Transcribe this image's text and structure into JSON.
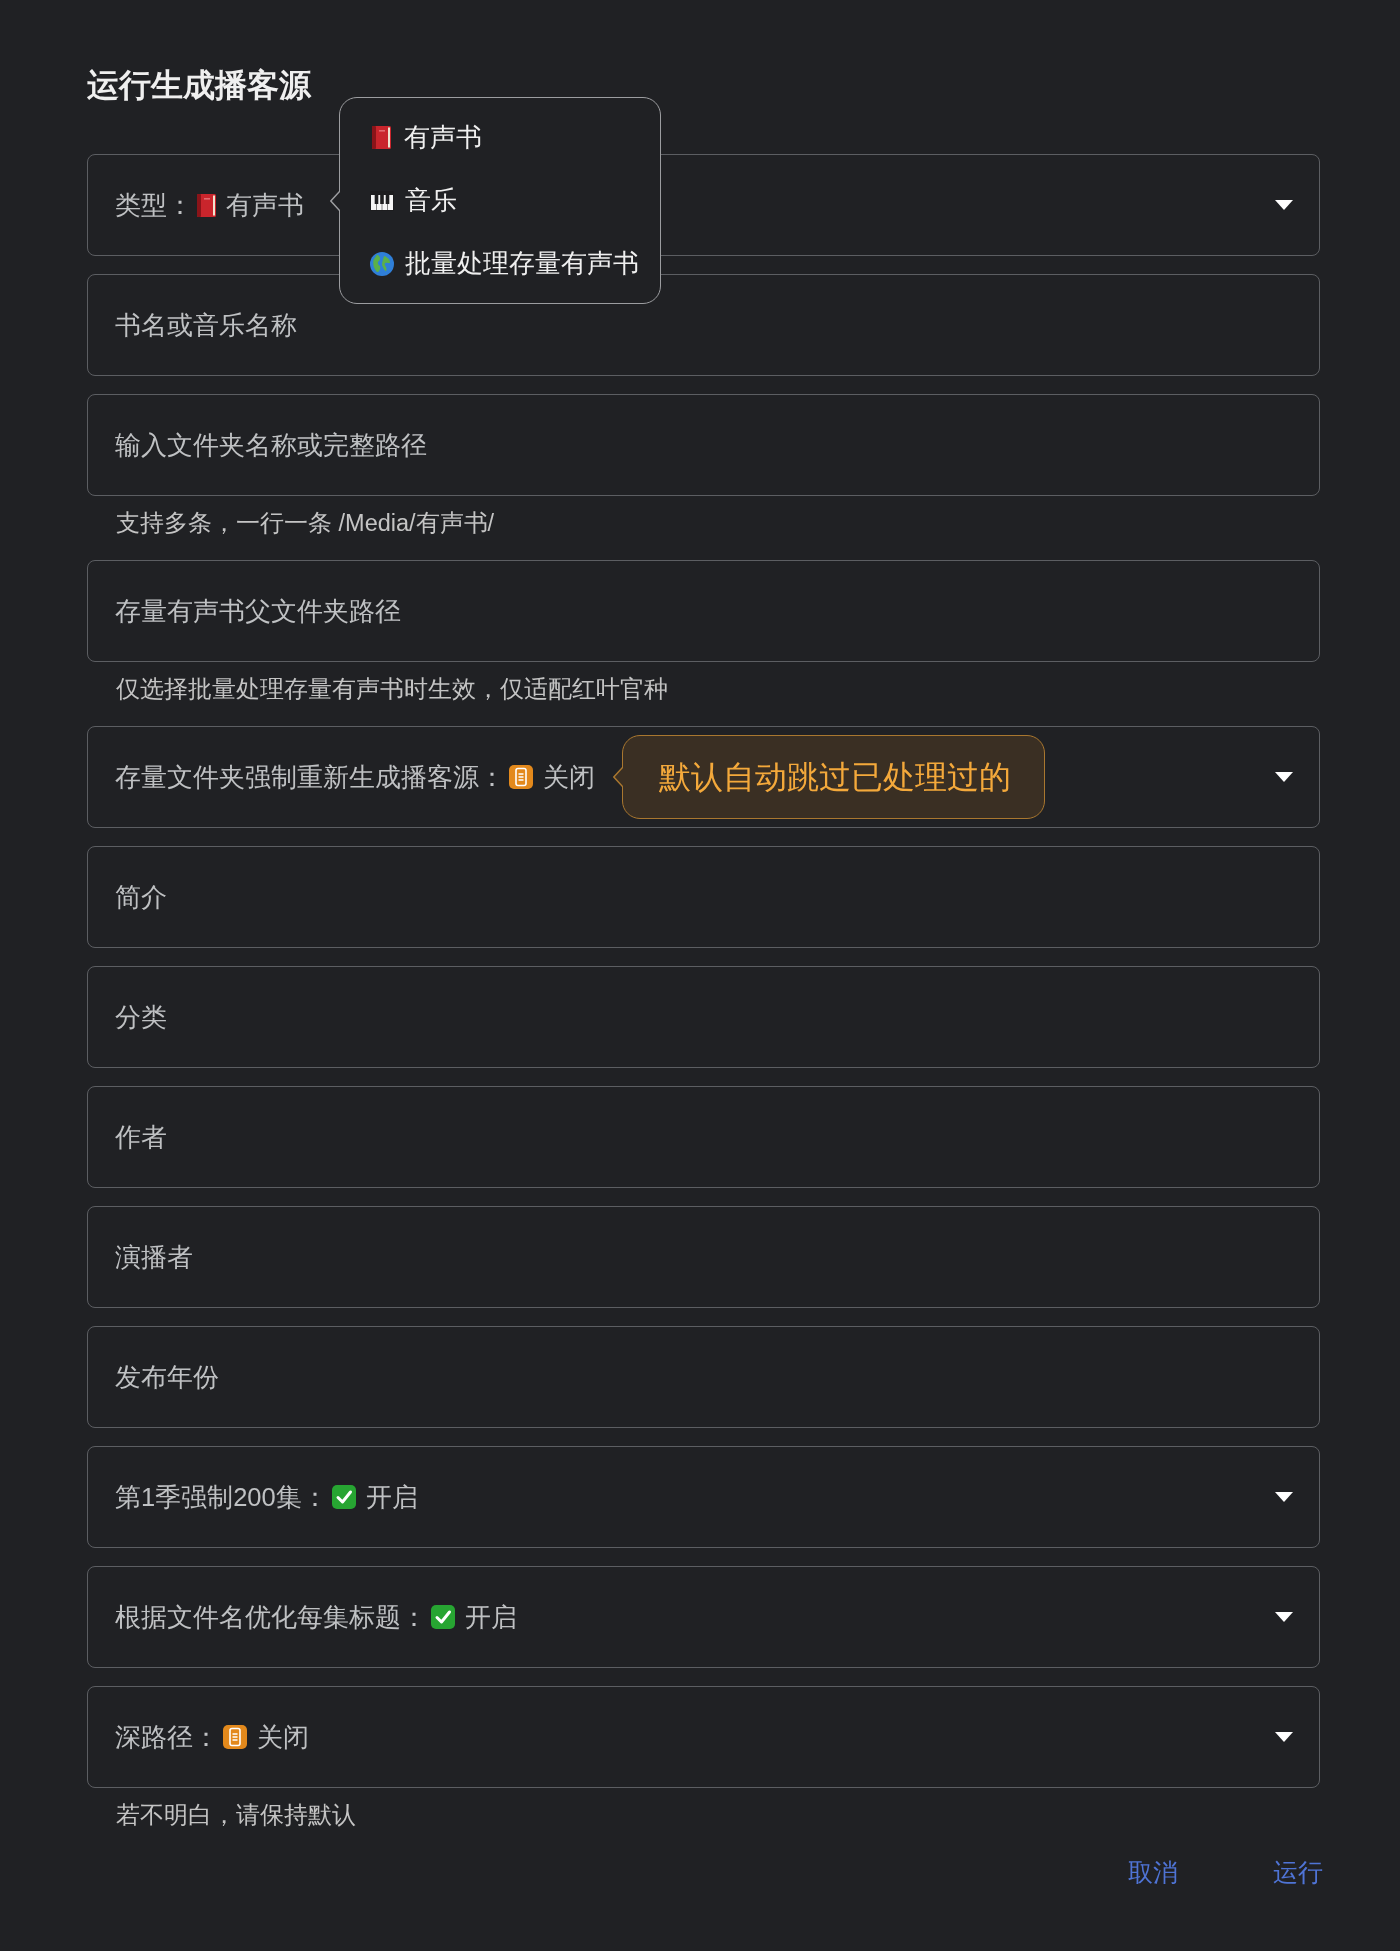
{
  "dialog": {
    "title": "运行生成播客源"
  },
  "fields": [
    {
      "kind": "select",
      "label": "类型：",
      "value": {
        "label": "有声书",
        "kind": "audiobook"
      },
      "menu": {
        "items": [
          {
            "label": "有声书",
            "kind": "audiobook",
            "selected": false
          },
          {
            "label": "音乐",
            "kind": "music",
            "selected": false
          },
          {
            "label": "批量处理存量有声书",
            "kind": "batch",
            "selected": false
          }
        ]
      }
    },
    {
      "kind": "text",
      "placeholder": "书名或音乐名称"
    },
    {
      "kind": "text",
      "placeholder": "输入文件夹名称或完整路径",
      "help": "支持多条，一行一条 /Media/有声书/"
    },
    {
      "kind": "text",
      "placeholder": "存量有声书父文件夹路径",
      "help": "仅选择批量处理存量有声书时生效，仅适配红叶官种"
    },
    {
      "kind": "select",
      "label": "存量文件夹强制重新生成播客源：",
      "value": {
        "label": "关闭",
        "on": false
      },
      "tooltip": "默认自动跳过已处理过的"
    },
    {
      "kind": "text",
      "placeholder": "简介"
    },
    {
      "kind": "text",
      "placeholder": "分类"
    },
    {
      "kind": "text",
      "placeholder": "作者"
    },
    {
      "kind": "text",
      "placeholder": "演播者"
    },
    {
      "kind": "text",
      "placeholder": "发布年份"
    },
    {
      "kind": "select",
      "label": "第1季强制200集：",
      "value": {
        "label": "开启",
        "on": true
      }
    },
    {
      "kind": "select",
      "label": "根据文件名优化每集标题：",
      "value": {
        "label": "开启",
        "on": true
      }
    },
    {
      "kind": "select",
      "label": "深路径：",
      "value": {
        "label": "关闭",
        "on": false
      },
      "help": "若不明白，请保持默认"
    }
  ],
  "buttons": [
    {
      "label": "取消"
    },
    {
      "label": "运行"
    }
  ]
}
